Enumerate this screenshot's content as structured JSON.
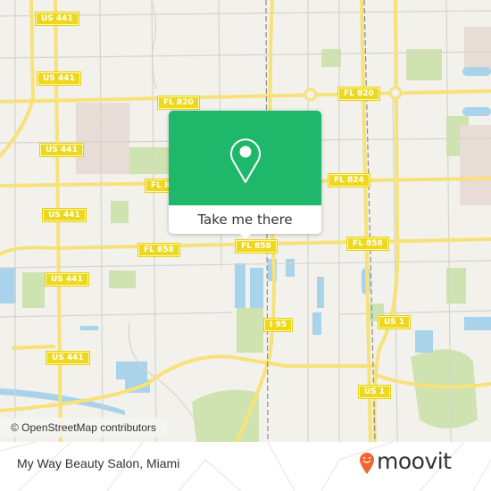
{
  "map": {
    "road_labels": [
      {
        "text": "US 441",
        "road": "us-441"
      },
      {
        "text": "US 441",
        "road": "us-441"
      },
      {
        "text": "US 441",
        "road": "us-441"
      },
      {
        "text": "US 441",
        "road": "us-441"
      },
      {
        "text": "US 441",
        "road": "us-441"
      },
      {
        "text": "US 441",
        "road": "us-441"
      },
      {
        "text": "FL 820",
        "road": "fl-820"
      },
      {
        "text": "FL 820",
        "road": "fl-820"
      },
      {
        "text": "FL 824",
        "road": "fl-824"
      },
      {
        "text": "FL 8",
        "road": "fl-824"
      },
      {
        "text": "FL 858",
        "road": "fl-858"
      },
      {
        "text": "FL 858",
        "road": "fl-858"
      },
      {
        "text": "FL 858",
        "road": "fl-858"
      },
      {
        "text": "I 95",
        "road": "i-95"
      },
      {
        "text": "US 1",
        "road": "us-1"
      },
      {
        "text": "US 1",
        "road": "us-1"
      }
    ],
    "colors": {
      "background": "#f2f1ec",
      "road_major": "#f7e27a",
      "road_minor": "#d6d4cc",
      "water": "#a9d3ea",
      "park": "#cfe3b0",
      "shield": "#eed81e"
    }
  },
  "popup": {
    "icon": "map-pin-icon",
    "button_label": "Take me there",
    "color": "#1fb76a"
  },
  "attribution": "© OpenStreetMap contributors",
  "footer": {
    "place_name": "My Way Beauty Salon, Miami",
    "brand": "moovit",
    "brand_icon": "moovit-pin-icon",
    "brand_color": "#f26532"
  }
}
